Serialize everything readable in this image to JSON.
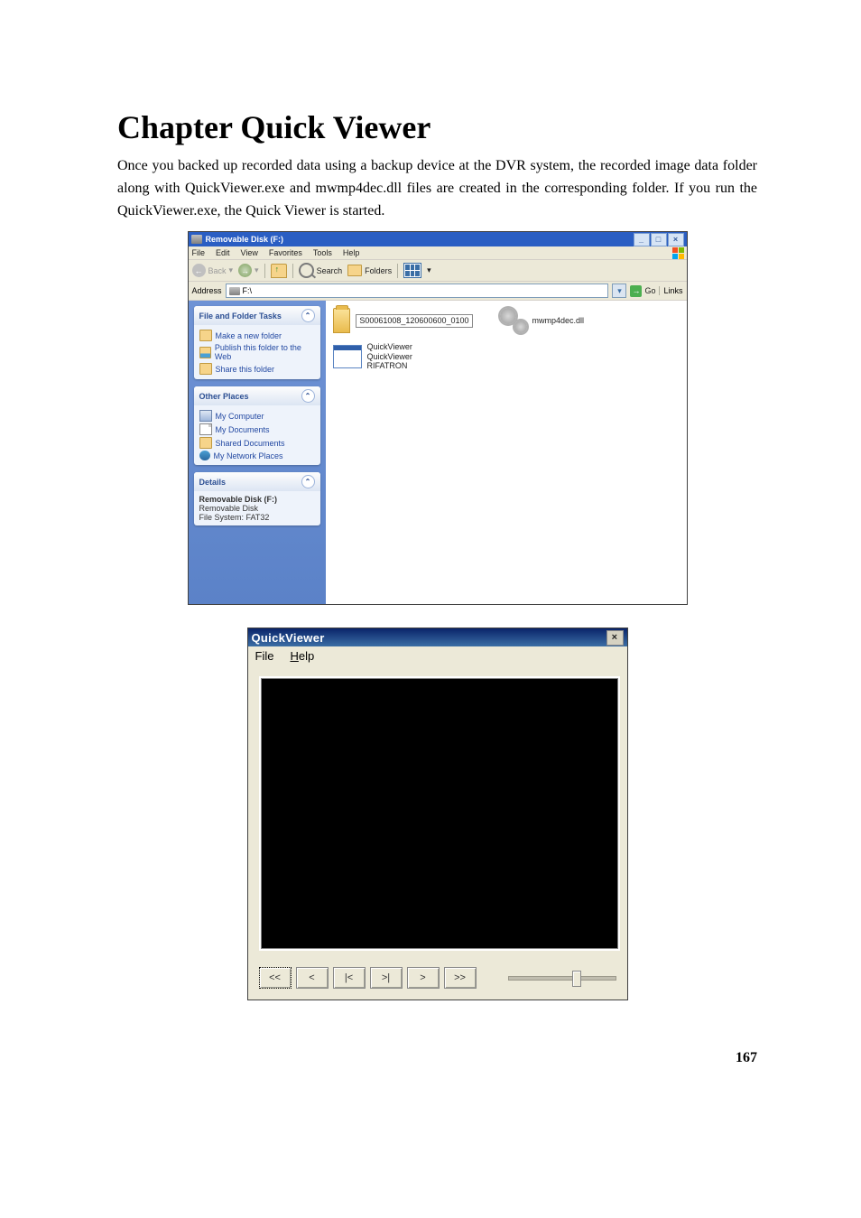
{
  "chapter_title": "Chapter    Quick Viewer",
  "body_text": "Once you backed up recorded data using a backup device at the DVR system, the recorded image data folder along with QuickViewer.exe and mwmp4dec.dll files are created in the corresponding folder. If you run the QuickViewer.exe, the Quick Viewer is started.",
  "page_number": "167",
  "explorer": {
    "title": "Removable Disk (F:)",
    "menu": [
      "File",
      "Edit",
      "View",
      "Favorites",
      "Tools",
      "Help"
    ],
    "toolbar": {
      "back": "Back",
      "search": "Search",
      "folders": "Folders"
    },
    "address": {
      "label": "Address",
      "value": "F:\\",
      "go": "Go",
      "links": "Links"
    },
    "side": {
      "tasks": {
        "title": "File and Folder Tasks",
        "items": [
          "Make a new folder",
          "Publish this folder to the Web",
          "Share this folder"
        ]
      },
      "places": {
        "title": "Other Places",
        "items": [
          "My Computer",
          "My Documents",
          "Shared Documents",
          "My Network Places"
        ]
      },
      "details": {
        "title": "Details",
        "name": "Removable Disk (F:)",
        "type": "Removable Disk",
        "fs": "File System: FAT32"
      }
    },
    "files": {
      "folder1": "S00061008_120600600_0100",
      "app_name": "QuickViewer",
      "app_type": "QuickViewer",
      "app_vendor": "RIFATRON",
      "dll": "mwmp4dec.dll"
    }
  },
  "qv": {
    "title": "QuickViewer",
    "menu_file": "File",
    "menu_help": "Help",
    "buttons": {
      "rewind_fast": "<<",
      "step_back": "<",
      "goto_start": "|<",
      "goto_end": ">|",
      "step_fwd": ">",
      "forward_fast": ">>"
    }
  }
}
